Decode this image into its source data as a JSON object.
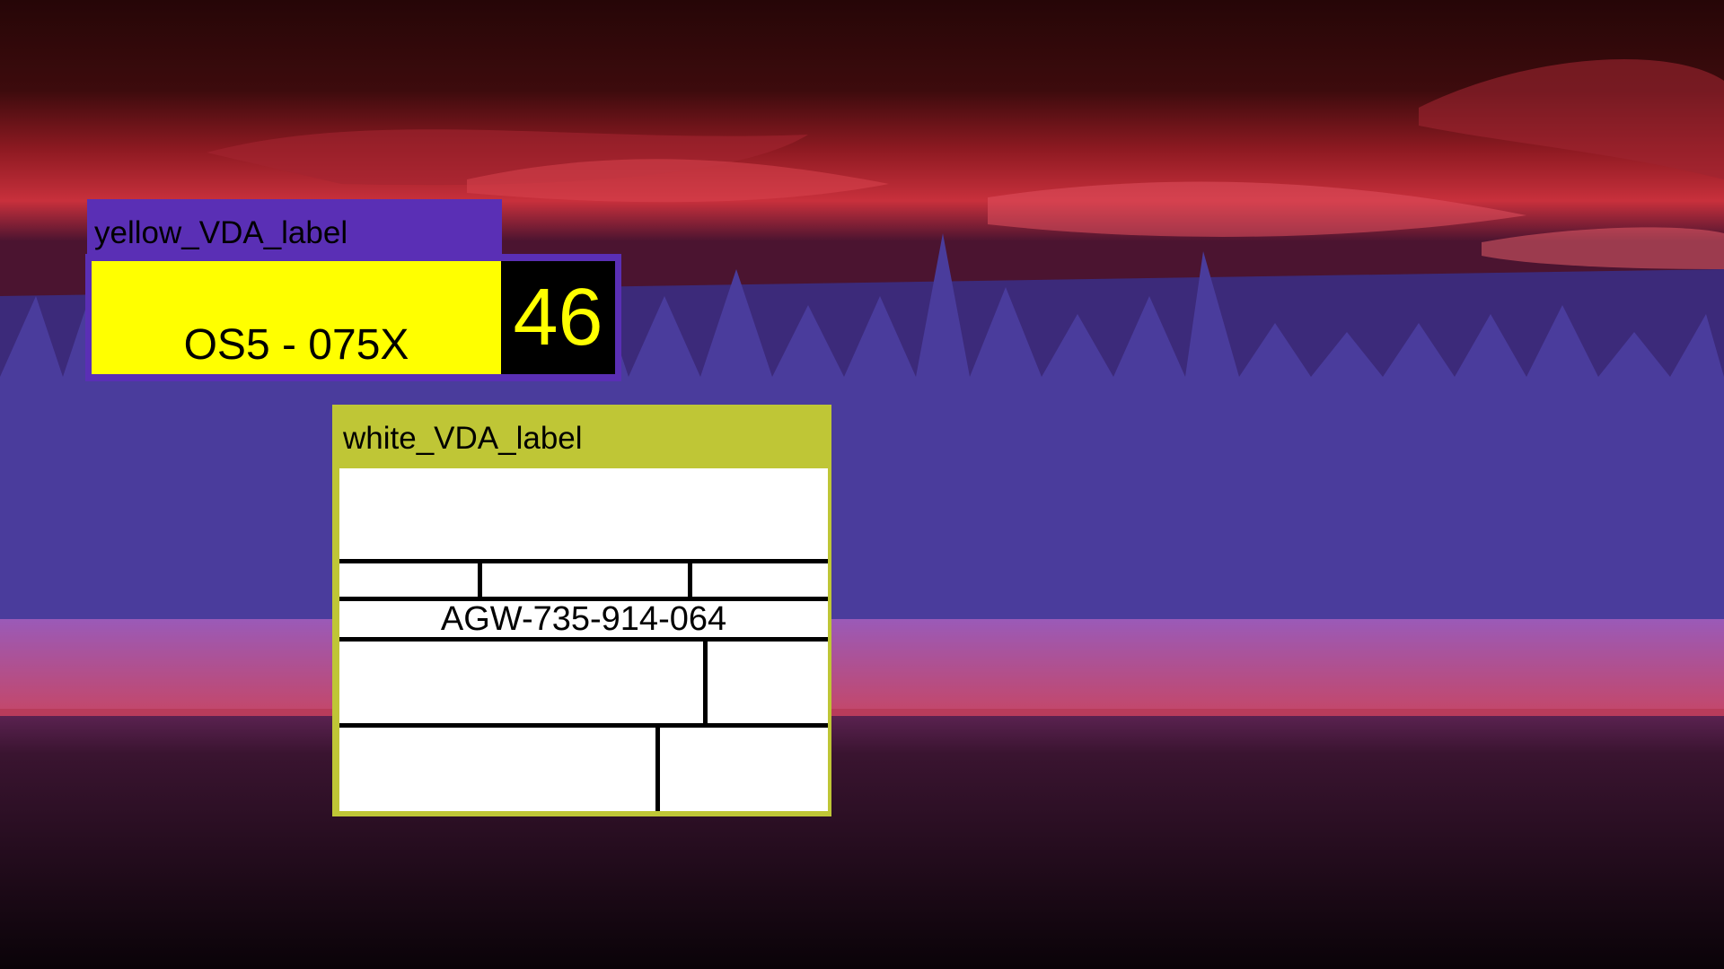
{
  "yellow_label": {
    "tag": "yellow_VDA_label",
    "code": "OS5 - 075X",
    "number": "46",
    "colors": {
      "frame": "#5a2fb5",
      "plate": "#ffff00",
      "number_bg": "#000000"
    }
  },
  "white_label": {
    "tag": "white_VDA_label",
    "code": "AGW-735-914-064",
    "colors": {
      "frame": "#bfc636",
      "plate": "#ffffff",
      "lines": "#000000"
    }
  }
}
